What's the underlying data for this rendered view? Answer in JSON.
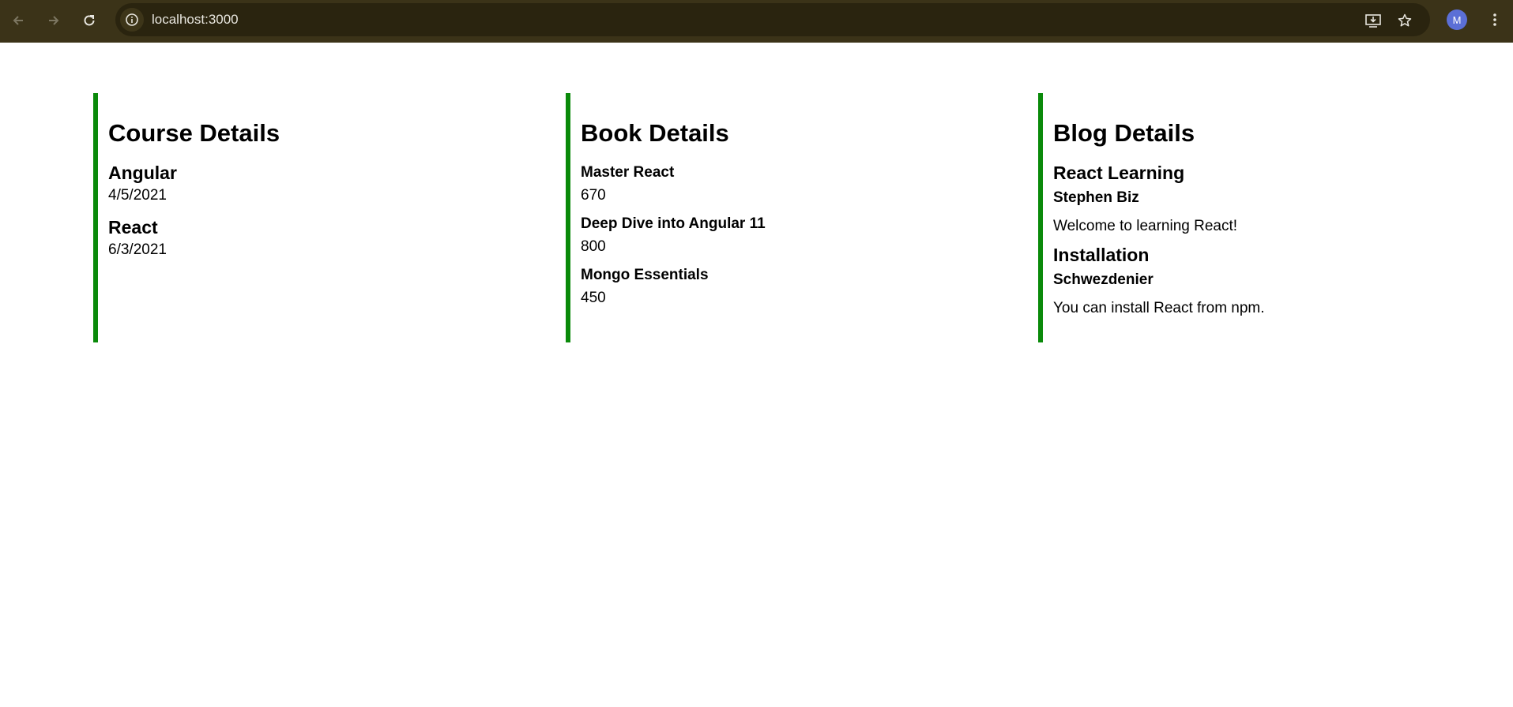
{
  "browser": {
    "url": "localhost:3000",
    "avatar_initial": "M"
  },
  "course": {
    "heading": "Course Details",
    "items": [
      {
        "name": "Angular",
        "date": "4/5/2021"
      },
      {
        "name": "React",
        "date": "6/3/2021"
      }
    ]
  },
  "book": {
    "heading": "Book Details",
    "items": [
      {
        "name": "Master React",
        "price": "670"
      },
      {
        "name": "Deep Dive into Angular 11",
        "price": "800"
      },
      {
        "name": "Mongo Essentials",
        "price": "450"
      }
    ]
  },
  "blog": {
    "heading": "Blog Details",
    "items": [
      {
        "title": "React Learning",
        "author": "Stephen Biz",
        "content": "Welcome to learning React!"
      },
      {
        "title": "Installation",
        "author": "Schwezdenier",
        "content": "You can install React from npm."
      }
    ]
  },
  "colors": {
    "accent_border": "#0a8a0a",
    "browser_bar": "#3b3318"
  },
  "icons": {
    "back": "back-arrow-icon",
    "forward": "forward-arrow-icon",
    "reload": "reload-icon",
    "site_info": "info-icon",
    "install": "install-app-icon",
    "bookmark": "star-icon",
    "menu": "kebab-menu-icon"
  }
}
